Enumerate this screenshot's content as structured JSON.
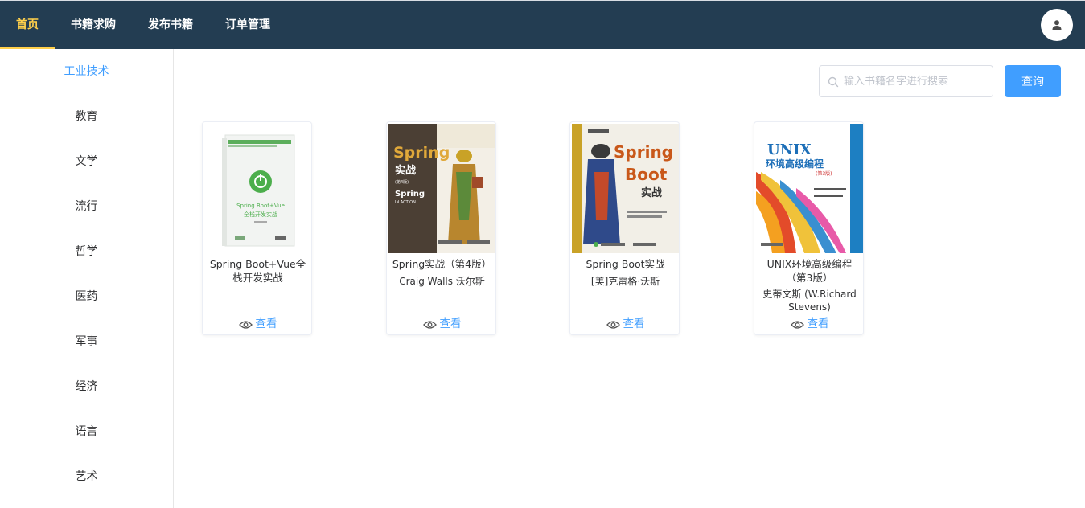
{
  "nav": {
    "items": [
      {
        "label": "首页",
        "active": true
      },
      {
        "label": "书籍求购",
        "active": false
      },
      {
        "label": "发布书籍",
        "active": false
      },
      {
        "label": "订单管理",
        "active": false
      }
    ],
    "avatar_icon": "user-icon"
  },
  "sidebar": {
    "items": [
      {
        "label": "工业技术",
        "active": true
      },
      {
        "label": "教育",
        "active": false
      },
      {
        "label": "文学",
        "active": false
      },
      {
        "label": "流行",
        "active": false
      },
      {
        "label": "哲学",
        "active": false
      },
      {
        "label": "医药",
        "active": false
      },
      {
        "label": "军事",
        "active": false
      },
      {
        "label": "经济",
        "active": false
      },
      {
        "label": "语言",
        "active": false
      },
      {
        "label": "艺术",
        "active": false
      }
    ]
  },
  "search": {
    "placeholder": "输入书籍名字进行搜索",
    "value": "",
    "button_label": "查询"
  },
  "books": [
    {
      "title": "Spring Boot+Vue全栈开发实战",
      "author": "",
      "view_label": "查看",
      "cover_text": "Spring Boot+Vue 全栈开发实战"
    },
    {
      "title": "Spring实战（第4版）",
      "author": "Craig Walls 沃尔斯",
      "view_label": "查看",
      "cover_text": "Spring 实战 (第4版) Spring IN ACTION"
    },
    {
      "title": "Spring Boot实战",
      "author": "[美]克雷格·沃斯",
      "view_label": "查看",
      "cover_text": "Spring Boot 实战"
    },
    {
      "title": "UNIX环境高级编程（第3版）",
      "author": "史蒂文斯 (W.Richard Stevens)",
      "view_label": "查看",
      "cover_text": "UNIX 环境高级编程 (第3版)"
    }
  ],
  "colors": {
    "nav_bg": "#233d52",
    "nav_active": "#ffd04b",
    "accent": "#409eff"
  }
}
